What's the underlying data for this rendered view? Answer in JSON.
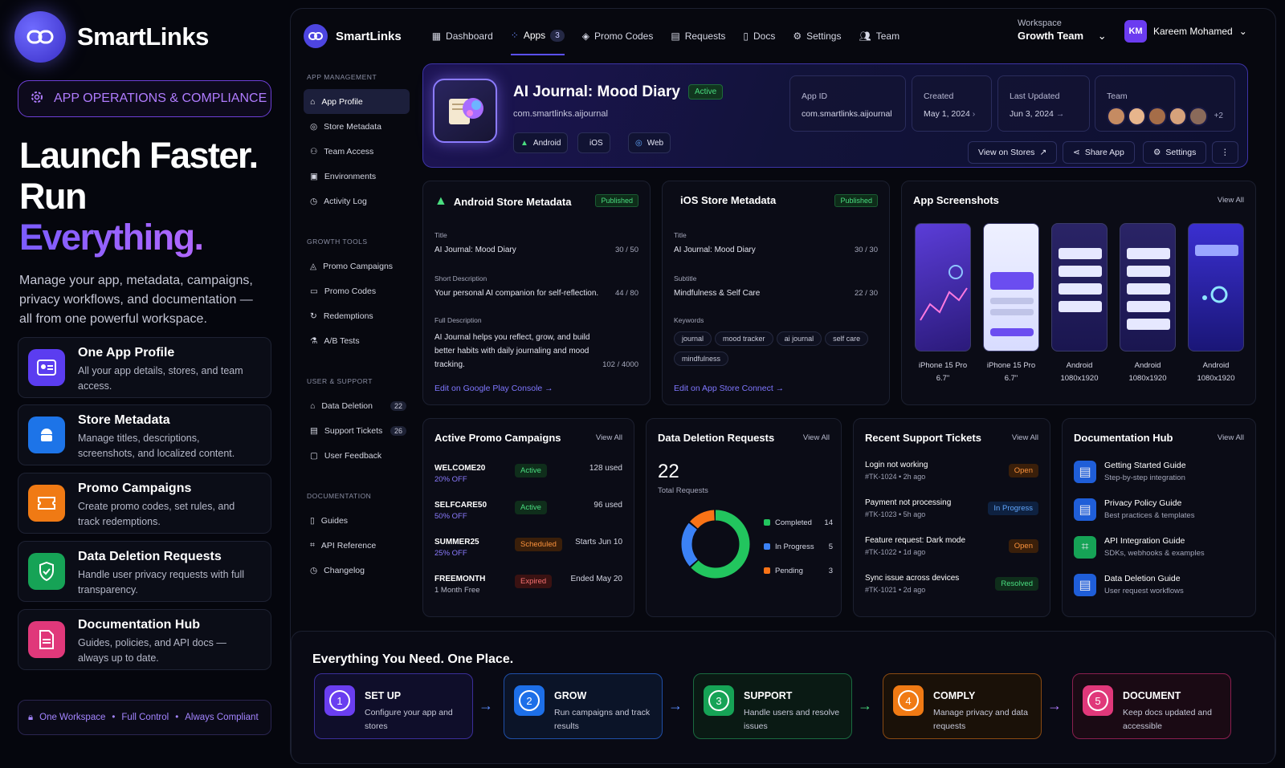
{
  "brand": {
    "name": "SmartLinks",
    "tag": "APP OPERATIONS & COMPLIANCE"
  },
  "hero": {
    "line1": "Launch Faster.",
    "line2": "Run",
    "line3": "Everything.",
    "sub": "Manage your app, metadata, campaigns, privacy workflows, and documentation — all from one powerful workspace."
  },
  "features": [
    {
      "title": "One App Profile",
      "desc": "All your app details, stores, and team access."
    },
    {
      "title": "Store Metadata",
      "desc": "Manage titles, descriptions, screenshots, and localized content."
    },
    {
      "title": "Promo Campaigns",
      "desc": "Create promo codes, set rules, and track redemptions."
    },
    {
      "title": "Data Deletion Requests",
      "desc": "Handle user privacy requests with full transparency."
    },
    {
      "title": "Documentation Hub",
      "desc": "Guides, policies, and API docs — always up to date."
    }
  ],
  "footer": {
    "a": "One Workspace",
    "b": "Full Control",
    "c": "Always Compliant"
  },
  "nav": {
    "items": [
      "Dashboard",
      "Apps",
      "Promo Codes",
      "Requests",
      "Docs",
      "Settings",
      "Team"
    ],
    "apps_badge": "3",
    "workspace_label": "Workspace",
    "workspace_name": "Growth Team",
    "user_initials": "KM",
    "user_name": "Kareem Mohamed"
  },
  "sidebar": {
    "app_mgmt": "APP MANAGEMENT",
    "app_items": [
      "App Profile",
      "Store Metadata",
      "Team Access",
      "Environments",
      "Activity Log"
    ],
    "growth": "GROWTH TOOLS",
    "growth_items": [
      "Promo Campaigns",
      "Promo Codes",
      "Redemptions",
      "A/B Tests"
    ],
    "support": "USER & SUPPORT",
    "support_items": [
      "Data Deletion",
      "Support Tickets",
      "User Feedback"
    ],
    "support_badges": [
      "22",
      "26"
    ],
    "docs": "DOCUMENTATION",
    "docs_items": [
      "Guides",
      "API Reference",
      "Changelog"
    ]
  },
  "app": {
    "name": "AI Journal: Mood Diary",
    "status": "Active",
    "bundle": "com.smartlinks.aijournal",
    "platforms": [
      "Android",
      "iOS",
      "Web"
    ],
    "app_id_label": "App ID",
    "app_id": "com.smartlinks.aijournal",
    "created_label": "Created",
    "created": "May 1, 2024",
    "updated_label": "Last Updated",
    "updated": "Jun 3, 2024",
    "team_label": "Team",
    "team_more": "+2",
    "btn_view": "View on Stores",
    "btn_share": "Share App",
    "btn_settings": "Settings"
  },
  "android_meta": {
    "title": "Android Store Metadata",
    "status": "Published",
    "f1_l": "Title",
    "f1_v": "AI Journal: Mood Diary",
    "f1_n": "30 / 50",
    "f2_l": "Short Description",
    "f2_v": "Your personal AI companion for self-reflection.",
    "f2_n": "44 / 80",
    "f3_l": "Full Description",
    "f3_v": "AI Journal helps you reflect, grow, and build better habits with daily journaling and mood tracking.",
    "f3_n": "102 / 4000",
    "link": "Edit on Google Play Console →"
  },
  "ios_meta": {
    "title": "iOS Store Metadata",
    "status": "Published",
    "f1_l": "Title",
    "f1_v": "AI Journal: Mood Diary",
    "f1_n": "30 / 30",
    "f2_l": "Subtitle",
    "f2_v": "Mindfulness & Self Care",
    "f2_n": "22 / 30",
    "f3_l": "Keywords",
    "keywords": [
      "journal",
      "mood tracker",
      "ai journal",
      "self care",
      "mindfulness"
    ],
    "link": "Edit on App Store Connect →"
  },
  "screenshots": {
    "title": "App Screenshots",
    "view_all": "View All",
    "items": [
      {
        "device": "iPhone 15 Pro",
        "size": "6.7\""
      },
      {
        "device": "iPhone 15 Pro",
        "size": "6.7\""
      },
      {
        "device": "Android",
        "size": "1080x1920"
      },
      {
        "device": "Android",
        "size": "1080x1920"
      },
      {
        "device": "Android",
        "size": "1080x1920"
      }
    ]
  },
  "promos": {
    "title": "Active Promo Campaigns",
    "view_all": "View All",
    "rows": [
      {
        "code": "WELCOME20",
        "deal": "20% OFF",
        "status": "Active",
        "info": "128 used"
      },
      {
        "code": "SELFCARE50",
        "deal": "50% OFF",
        "status": "Active",
        "info": "96 used"
      },
      {
        "code": "SUMMER25",
        "deal": "25% OFF",
        "status": "Scheduled",
        "info": "Starts Jun 10"
      },
      {
        "code": "FREEMONTH",
        "deal": "1 Month Free",
        "status": "Expired",
        "info": "Ended May 20"
      }
    ]
  },
  "deletion": {
    "title": "Data Deletion Requests",
    "view_all": "View All",
    "total": "22",
    "total_label": "Total Requests",
    "legend": [
      {
        "label": "Completed",
        "value": 14,
        "color": "#22c55e"
      },
      {
        "label": "In Progress",
        "value": 5,
        "color": "#3b82f6"
      },
      {
        "label": "Pending",
        "value": 3,
        "color": "#f97316"
      }
    ]
  },
  "tickets": {
    "title": "Recent Support Tickets",
    "view_all": "View All",
    "rows": [
      {
        "title": "Login not working",
        "meta": "#TK-1024 • 2h ago",
        "status": "Open"
      },
      {
        "title": "Payment not processing",
        "meta": "#TK-1023 • 5h ago",
        "status": "In Progress"
      },
      {
        "title": "Feature request: Dark mode",
        "meta": "#TK-1022 • 1d ago",
        "status": "Open"
      },
      {
        "title": "Sync issue across devices",
        "meta": "#TK-1021 • 2d ago",
        "status": "Resolved"
      }
    ]
  },
  "docs_hub": {
    "title": "Documentation Hub",
    "view_all": "View All",
    "rows": [
      {
        "title": "Getting Started Guide",
        "desc": "Step-by-step integration"
      },
      {
        "title": "Privacy Policy Guide",
        "desc": "Best practices & templates"
      },
      {
        "title": "API Integration Guide",
        "desc": "SDKs, webhooks & examples"
      },
      {
        "title": "Data Deletion Guide",
        "desc": "User request workflows"
      }
    ]
  },
  "flow": {
    "title": "Everything You Need. One Place.",
    "steps": [
      {
        "n": "1",
        "title": "SET UP",
        "desc": "Configure your app and stores"
      },
      {
        "n": "2",
        "title": "GROW",
        "desc": "Run campaigns and track results"
      },
      {
        "n": "3",
        "title": "SUPPORT",
        "desc": "Handle users and resolve issues"
      },
      {
        "n": "4",
        "title": "COMPLY",
        "desc": "Manage privacy and data requests"
      },
      {
        "n": "5",
        "title": "DOCUMENT",
        "desc": "Keep docs updated and accessible"
      }
    ]
  }
}
